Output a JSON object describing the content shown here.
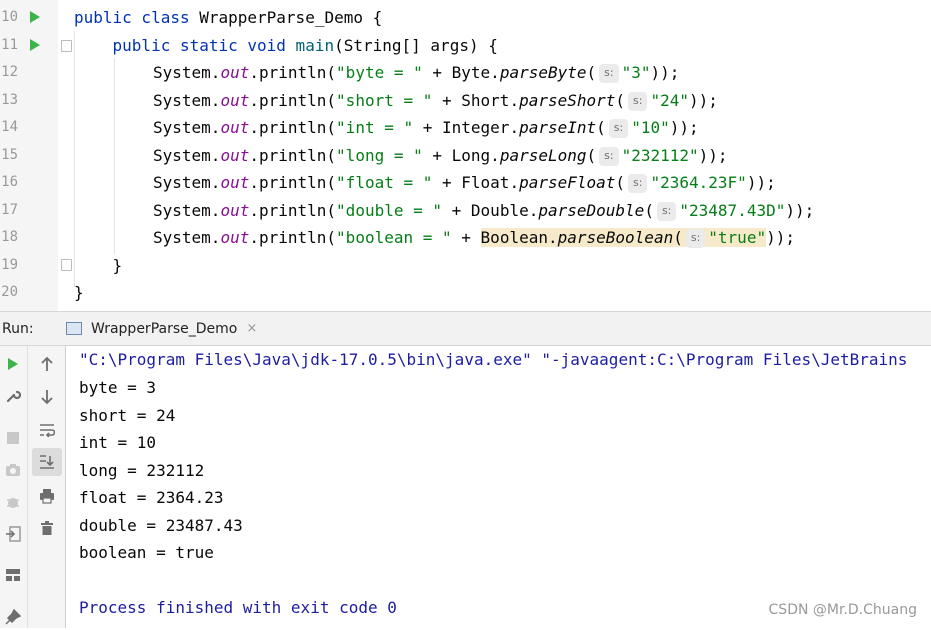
{
  "editor": {
    "line_numbers": [
      "10",
      "11",
      "12",
      "13",
      "14",
      "15",
      "16",
      "17",
      "18",
      "19",
      "20"
    ],
    "lines": [
      {
        "pre": "",
        "kw1": "public class",
        "rest": " WrapperParse_Demo {"
      },
      {
        "indent": "    ",
        "kw1": "public static void",
        "name": " main",
        "rest": "(String[] args) {"
      },
      {
        "obj": "System.",
        "fld": "out",
        "call": ".println(",
        "label": "\"byte = \"",
        "plus": " + Byte.",
        "method": "parseByte",
        "open": "(",
        "hint": "s:",
        "arg": "\"3\"",
        "close": "));"
      },
      {
        "obj": "System.",
        "fld": "out",
        "call": ".println(",
        "label": "\"short = \"",
        "plus": " + Short.",
        "method": "parseShort",
        "open": "(",
        "hint": "s:",
        "arg": "\"24\"",
        "close": "));"
      },
      {
        "obj": "System.",
        "fld": "out",
        "call": ".println(",
        "label": "\"int = \"",
        "plus": " + Integer.",
        "method": "parseInt",
        "open": "(",
        "hint": "s:",
        "arg": "\"10\"",
        "close": "));"
      },
      {
        "obj": "System.",
        "fld": "out",
        "call": ".println(",
        "label": "\"long = \"",
        "plus": " + Long.",
        "method": "parseLong",
        "open": "(",
        "hint": "s:",
        "arg": "\"232112\"",
        "close": "));"
      },
      {
        "obj": "System.",
        "fld": "out",
        "call": ".println(",
        "label": "\"float = \"",
        "plus": " + Float.",
        "method": "parseFloat",
        "open": "(",
        "hint": "s:",
        "arg": "\"2364.23F\"",
        "close": "));"
      },
      {
        "obj": "System.",
        "fld": "out",
        "call": ".println(",
        "label": "\"double = \"",
        "plus": " + Double.",
        "method": "parseDouble",
        "open": "(",
        "hint": "s:",
        "arg": "\"23487.43D\"",
        "close": "));"
      },
      {
        "obj": "System.",
        "fld": "out",
        "call": ".println(",
        "label": "\"boolean = \"",
        "plus": " + ",
        "cls": "Boolean.",
        "method": "parseBoolean",
        "open": "(",
        "hint": "s:",
        "arg": "\"true\"",
        "close": "));"
      },
      {
        "text": "    }"
      },
      {
        "text": "}"
      }
    ]
  },
  "run_panel": {
    "label": "Run:",
    "tab_title": "WrapperParse_Demo",
    "tab_close": "×"
  },
  "console": {
    "command": "\"C:\\Program Files\\Java\\jdk-17.0.5\\bin\\java.exe\" \"-javaagent:C:\\Program Files\\JetBrains",
    "output": [
      "byte = 3",
      "short = 24",
      "int = 10",
      "long = 232112",
      "float = 2364.23",
      "double = 23487.43",
      "boolean = true"
    ],
    "finish": "Process finished with exit code 0"
  },
  "watermark": "CSDN @Mr.D.Chuang",
  "colors": {
    "keyword": "#0033b3",
    "string": "#067d17",
    "field": "#871094",
    "run_arrow": "#3bb54a",
    "highlight": "#f7eacb"
  }
}
